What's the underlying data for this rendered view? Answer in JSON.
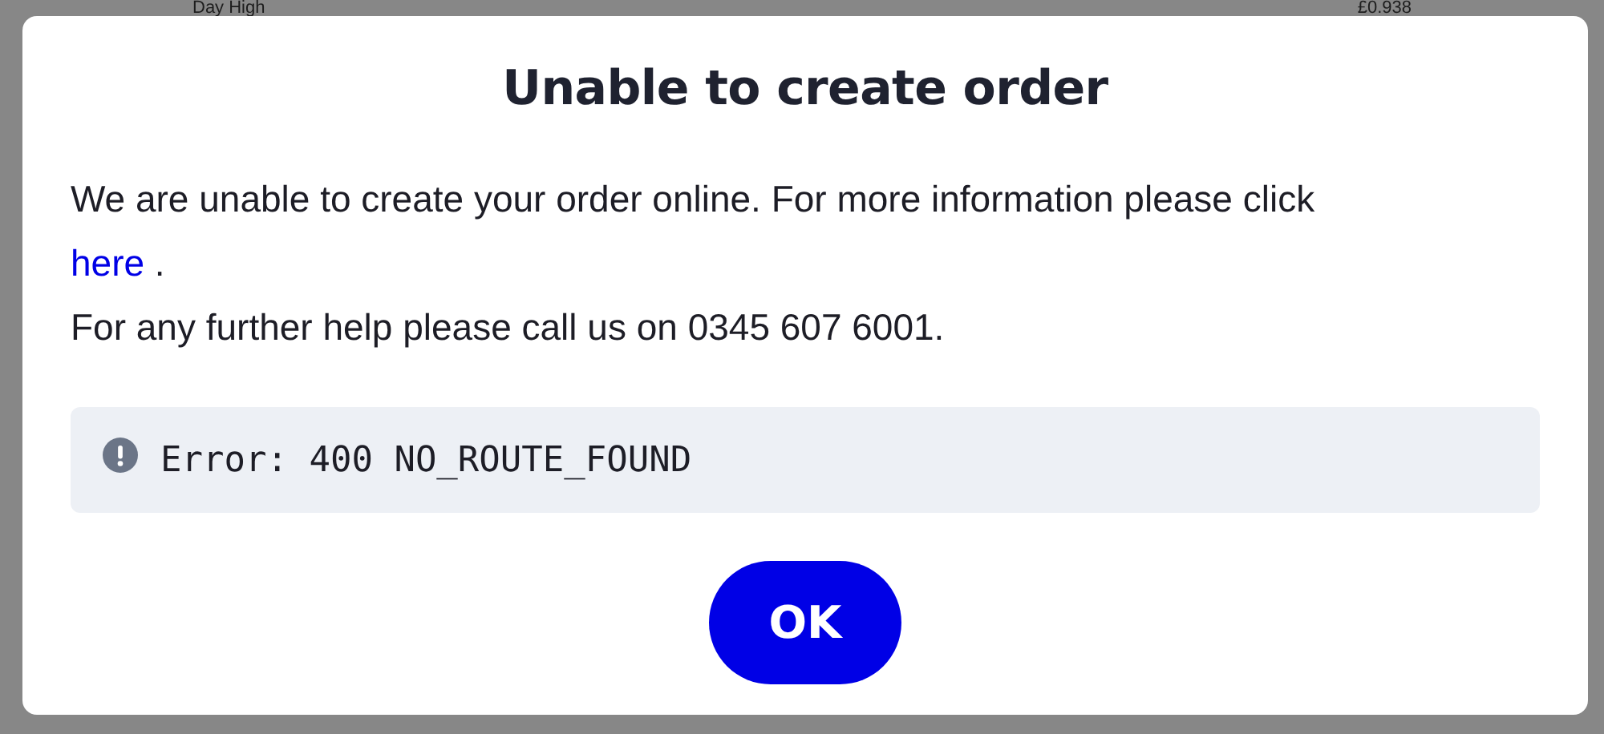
{
  "background_row": {
    "label": "Day High",
    "value": "£0.938"
  },
  "dialog": {
    "title": "Unable to create order",
    "message": [
      {
        "before": "We are unable to create your order online. For more information please click ",
        "link": "here",
        "after": " ."
      },
      {
        "before": "For any further help please call us on 0345 607 6001."
      }
    ],
    "error": {
      "text": "Error: 400 NO_ROUTE_FOUND"
    },
    "buttons": [
      {
        "label": "OK"
      }
    ]
  }
}
